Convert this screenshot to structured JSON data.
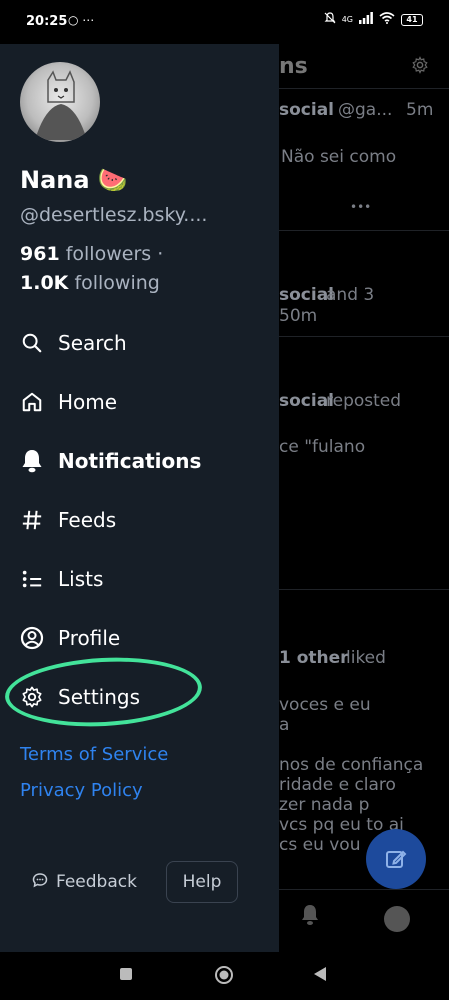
{
  "status_bar": {
    "time": "20:25",
    "left_icons": "○ ⋯",
    "network": "4G",
    "battery": "41"
  },
  "background": {
    "title_fragment": "ns",
    "post1_author": "social",
    "post1_handle": "@ga...",
    "post1_time": "5m",
    "post1_text": "Não sei como",
    "post1_more": "•••",
    "notif1_actor": "social",
    "notif1_rest": " and 3",
    "notif1_time": "50m",
    "notif2_actor": "social",
    "notif2_rest": " reposted",
    "notif2_text": "ce \"fulano",
    "notif3_actor": "1 other",
    "notif3_rest": " liked",
    "notif3_lines": [
      "voces e eu",
      "a",
      "",
      "nos de confiança",
      "ridade e claro",
      "zer nada p",
      "vcs pq eu to ai",
      "cs eu vou"
    ]
  },
  "profile": {
    "display_name": "Nana 🍉",
    "handle": "@desertlesz.bsky....",
    "followers_count": "961",
    "followers_label": "followers ·",
    "following_count": "1.0K",
    "following_label": "following"
  },
  "menu": [
    {
      "label": "Search",
      "icon": "search-icon"
    },
    {
      "label": "Home",
      "icon": "home-icon"
    },
    {
      "label": "Notifications",
      "icon": "bell-icon"
    },
    {
      "label": "Feeds",
      "icon": "hash-icon"
    },
    {
      "label": "Lists",
      "icon": "list-icon"
    },
    {
      "label": "Profile",
      "icon": "user-circle-icon"
    },
    {
      "label": "Settings",
      "icon": "gear-icon"
    }
  ],
  "links": {
    "terms": "Terms of Service",
    "privacy": "Privacy Policy"
  },
  "footer": {
    "feedback": "Feedback",
    "help": "Help"
  },
  "colors": {
    "drawer_bg": "#161e27",
    "link": "#2f83ef",
    "highlight": "#43e39a",
    "fab": "#1d4a9c"
  }
}
